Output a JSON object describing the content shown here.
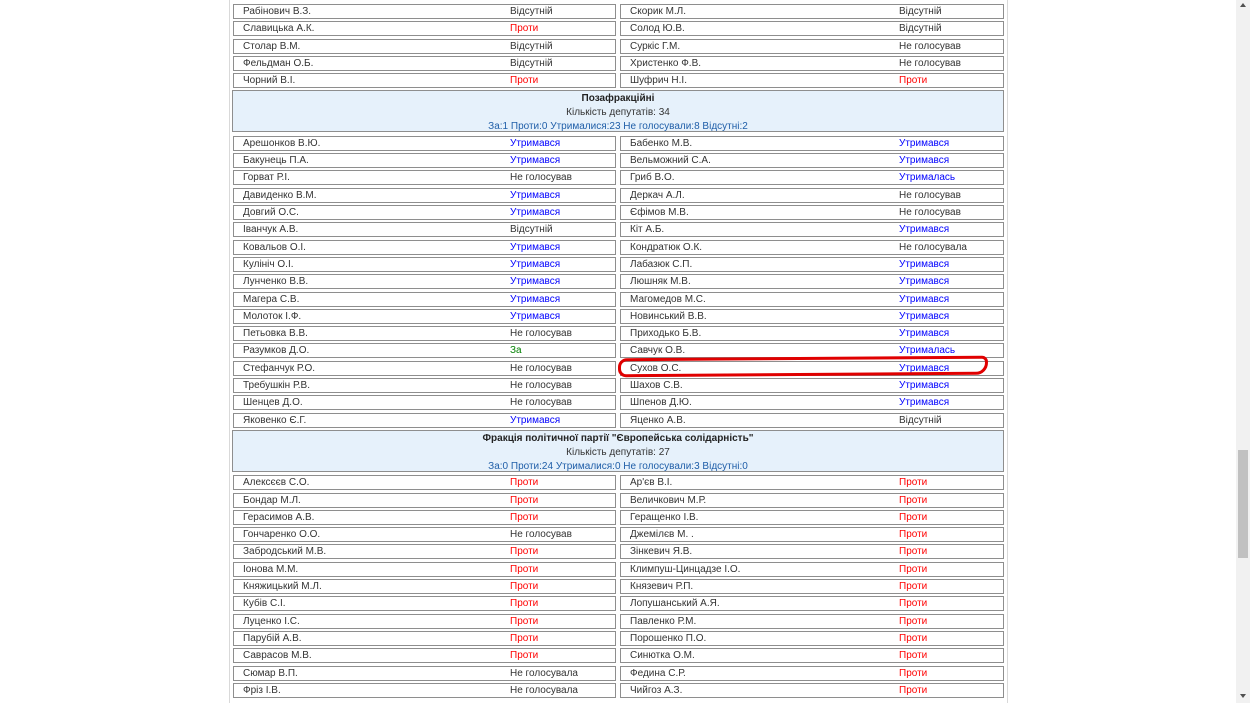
{
  "table": {
    "rows_top": [
      {
        "left": {
          "name": "Рабінович В.З.",
          "vote": "Відсутній",
          "type": "absent"
        },
        "right": {
          "name": "Скорик М.Л.",
          "vote": "Відсутній",
          "type": "absent"
        }
      },
      {
        "left": {
          "name": "Славицька А.К.",
          "vote": "Проти",
          "type": "against"
        },
        "right": {
          "name": "Солод Ю.В.",
          "vote": "Відсутній",
          "type": "absent"
        }
      },
      {
        "left": {
          "name": "Столар В.М.",
          "vote": "Відсутній",
          "type": "absent"
        },
        "right": {
          "name": "Суркіс Г.М.",
          "vote": "Не голосував",
          "type": "novote"
        }
      },
      {
        "left": {
          "name": "Фельдман О.Б.",
          "vote": "Відсутній",
          "type": "absent"
        },
        "right": {
          "name": "Христенко Ф.В.",
          "vote": "Не голосував",
          "type": "novote"
        }
      },
      {
        "left": {
          "name": "Чорний В.І.",
          "vote": "Проти",
          "type": "against"
        },
        "right": {
          "name": "Шуфрич Н.І.",
          "vote": "Проти",
          "type": "against"
        }
      }
    ],
    "groups": [
      {
        "title": "Позафракційні",
        "count": "Кількість депутатів: 34",
        "stats": "За:1 Проти:0 Утрималися:23 Не голосували:8 Відсутні:2",
        "rows": [
          {
            "left": {
              "name": "Арешонков В.Ю.",
              "vote": "Утримався",
              "type": "abstain"
            },
            "right": {
              "name": "Бабенко М.В.",
              "vote": "Утримався",
              "type": "abstain"
            }
          },
          {
            "left": {
              "name": "Бакунець П.А.",
              "vote": "Утримався",
              "type": "abstain"
            },
            "right": {
              "name": "Вельможний С.А.",
              "vote": "Утримався",
              "type": "abstain"
            }
          },
          {
            "left": {
              "name": "Горват Р.І.",
              "vote": "Не голосував",
              "type": "novote"
            },
            "right": {
              "name": "Гриб В.О.",
              "vote": "Утрималась",
              "type": "abstain"
            }
          },
          {
            "left": {
              "name": "Давиденко В.М.",
              "vote": "Утримався",
              "type": "abstain"
            },
            "right": {
              "name": "Деркач А.Л.",
              "vote": "Не голосував",
              "type": "novote"
            }
          },
          {
            "left": {
              "name": "Довгий О.С.",
              "vote": "Утримався",
              "type": "abstain"
            },
            "right": {
              "name": "Єфімов М.В.",
              "vote": "Не голосував",
              "type": "novote"
            }
          },
          {
            "left": {
              "name": "Іванчук А.В.",
              "vote": "Відсутній",
              "type": "absent"
            },
            "right": {
              "name": "Кіт А.Б.",
              "vote": "Утримався",
              "type": "abstain"
            }
          },
          {
            "left": {
              "name": "Ковальов О.І.",
              "vote": "Утримався",
              "type": "abstain"
            },
            "right": {
              "name": "Кондратюк О.К.",
              "vote": "Не голосувала",
              "type": "novote"
            }
          },
          {
            "left": {
              "name": "Кулініч О.І.",
              "vote": "Утримався",
              "type": "abstain"
            },
            "right": {
              "name": "Лабазюк С.П.",
              "vote": "Утримався",
              "type": "abstain"
            }
          },
          {
            "left": {
              "name": "Лунченко В.В.",
              "vote": "Утримався",
              "type": "abstain"
            },
            "right": {
              "name": "Люшняк М.В.",
              "vote": "Утримався",
              "type": "abstain"
            }
          },
          {
            "left": {
              "name": "Магера С.В.",
              "vote": "Утримався",
              "type": "abstain"
            },
            "right": {
              "name": "Магомедов М.С.",
              "vote": "Утримався",
              "type": "abstain"
            }
          },
          {
            "left": {
              "name": "Молоток І.Ф.",
              "vote": "Утримався",
              "type": "abstain"
            },
            "right": {
              "name": "Новинський В.В.",
              "vote": "Утримався",
              "type": "abstain"
            }
          },
          {
            "left": {
              "name": "Петьовка В.В.",
              "vote": "Не голосував",
              "type": "novote"
            },
            "right": {
              "name": "Приходько Б.В.",
              "vote": "Утримався",
              "type": "abstain"
            }
          },
          {
            "left": {
              "name": "Разумков Д.О.",
              "vote": "За",
              "type": "for"
            },
            "right": {
              "name": "Савчук О.В.",
              "vote": "Утрималась",
              "type": "abstain"
            }
          },
          {
            "left": {
              "name": "Стефанчук Р.О.",
              "vote": "Не голосував",
              "type": "novote"
            },
            "right": {
              "name": "Сухов О.С.",
              "vote": "Утримався",
              "type": "abstain"
            }
          },
          {
            "left": {
              "name": "Требушкін Р.В.",
              "vote": "Не голосував",
              "type": "novote"
            },
            "right": {
              "name": "Шахов С.В.",
              "vote": "Утримався",
              "type": "abstain"
            }
          },
          {
            "left": {
              "name": "Шенцев Д.О.",
              "vote": "Не голосував",
              "type": "novote"
            },
            "right": {
              "name": "Шпенов Д.Ю.",
              "vote": "Утримався",
              "type": "abstain"
            }
          },
          {
            "left": {
              "name": "Яковенко Є.Г.",
              "vote": "Утримався",
              "type": "abstain"
            },
            "right": {
              "name": "Яценко А.В.",
              "vote": "Відсутній",
              "type": "absent"
            }
          }
        ]
      },
      {
        "title": "Фракція політичної партії \"Європейська солідарність\"",
        "count": "Кількість депутатів: 27",
        "stats": "За:0 Проти:24 Утрималися:0 Не голосували:3 Відсутні:0",
        "rows": [
          {
            "left": {
              "name": "Алексєєв С.О.",
              "vote": "Проти",
              "type": "against"
            },
            "right": {
              "name": "Ар'єв В.І.",
              "vote": "Проти",
              "type": "against"
            }
          },
          {
            "left": {
              "name": "Бондар М.Л.",
              "vote": "Проти",
              "type": "against"
            },
            "right": {
              "name": "Величкович М.Р.",
              "vote": "Проти",
              "type": "against"
            }
          },
          {
            "left": {
              "name": "Герасимов А.В.",
              "vote": "Проти",
              "type": "against"
            },
            "right": {
              "name": "Геращенко І.В.",
              "vote": "Проти",
              "type": "against"
            }
          },
          {
            "left": {
              "name": "Гончаренко О.О.",
              "vote": "Не голосував",
              "type": "novote"
            },
            "right": {
              "name": "Джемілєв М. .",
              "vote": "Проти",
              "type": "against"
            }
          },
          {
            "left": {
              "name": "Забродський М.В.",
              "vote": "Проти",
              "type": "against"
            },
            "right": {
              "name": "Зінкевич Я.В.",
              "vote": "Проти",
              "type": "against"
            }
          },
          {
            "left": {
              "name": "Іонова М.М.",
              "vote": "Проти",
              "type": "against"
            },
            "right": {
              "name": "Климпуш-Цинцадзе І.О.",
              "vote": "Проти",
              "type": "against"
            }
          },
          {
            "left": {
              "name": "Княжицький М.Л.",
              "vote": "Проти",
              "type": "against"
            },
            "right": {
              "name": "Князевич Р.П.",
              "vote": "Проти",
              "type": "against"
            }
          },
          {
            "left": {
              "name": "Кубів С.І.",
              "vote": "Проти",
              "type": "against"
            },
            "right": {
              "name": "Лопушанський А.Я.",
              "vote": "Проти",
              "type": "against"
            }
          },
          {
            "left": {
              "name": "Луценко І.С.",
              "vote": "Проти",
              "type": "against"
            },
            "right": {
              "name": "Павленко Р.М.",
              "vote": "Проти",
              "type": "against"
            }
          },
          {
            "left": {
              "name": "Парубій А.В.",
              "vote": "Проти",
              "type": "against"
            },
            "right": {
              "name": "Порошенко П.О.",
              "vote": "Проти",
              "type": "against"
            }
          },
          {
            "left": {
              "name": "Саврасов М.В.",
              "vote": "Проти",
              "type": "against"
            },
            "right": {
              "name": "Синютка О.М.",
              "vote": "Проти",
              "type": "against"
            }
          },
          {
            "left": {
              "name": "Сюмар В.П.",
              "vote": "Не голосувала",
              "type": "novote"
            },
            "right": {
              "name": "Федина С.Р.",
              "vote": "Проти",
              "type": "against"
            }
          },
          {
            "left": {
              "name": "Фріз І.В.",
              "vote": "Не голосувала",
              "type": "novote"
            },
            "right": {
              "name": "Чийгоз А.З.",
              "vote": "Проти",
              "type": "against"
            }
          }
        ]
      }
    ]
  },
  "colors": {
    "against": "#ff0000",
    "abstain": "#0000ff",
    "for": "#008000",
    "group_bg": "#e6f1fb",
    "highlight": "#e00000"
  }
}
